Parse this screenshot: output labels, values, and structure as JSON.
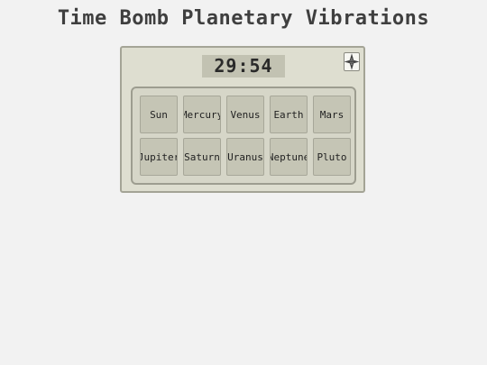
{
  "title": "Time Bomb Planetary Vibrations",
  "timer": "29:54",
  "compass_button_icon": "compass-rose-icon",
  "colors": {
    "background": "#f2f2f2",
    "panel": "#deded0",
    "timer_bg": "#c2c2b2",
    "button": "#c5c5b5",
    "border": "#a4a496"
  },
  "planets": [
    {
      "label": "Sun"
    },
    {
      "label": "Mercury"
    },
    {
      "label": "Venus"
    },
    {
      "label": "Earth"
    },
    {
      "label": "Mars"
    },
    {
      "label": "Jupiter"
    },
    {
      "label": "Saturn"
    },
    {
      "label": "Uranus"
    },
    {
      "label": "Neptune"
    },
    {
      "label": "Pluto"
    }
  ]
}
